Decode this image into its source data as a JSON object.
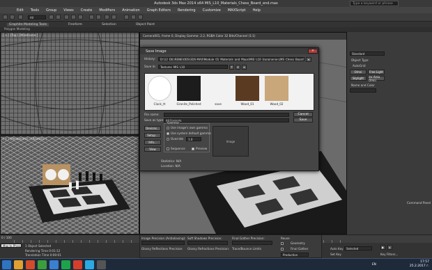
{
  "window": {
    "title": "Autodesk 3ds Max 2014 x64     MIS_L10_Materials_Chess_Board_end.max",
    "search_placeholder": "Type a keyword or phrase"
  },
  "menu": [
    "Edit",
    "Tools",
    "Group",
    "Views",
    "Create",
    "Modifiers",
    "Animation",
    "Graph Editors",
    "Rendering",
    "Customize",
    "MAXScript",
    "Help"
  ],
  "ribbon": {
    "tabs": [
      "Graphite Modeling Tools",
      "Freeform",
      "Selection",
      "Object Paint"
    ],
    "sub": "Polygon Modeling",
    "toolbar_select": "All"
  },
  "viewports": {
    "top_left": "[ + ] [Top ] [Wireframe ]",
    "bottom_left": "[ + ] [Perspective ] [Realistic ]",
    "right": "Camera001, frame 0, Display Gamma: 2.2, RGBA Color 32 Bits/Channel (1:1)"
  },
  "dialog": {
    "title": "Save Image",
    "history_label": "History:",
    "history_value": "D:\\12_DIL\\RENE\\ODS\\3DS MAX\\Module_01_Materials_and_Maps\\MIS_L10_Uprajnenie-LMS_Chess_Board\\Textures_MIS",
    "save_in_label": "Save in:",
    "save_in_value": "Textures_MIS_L10",
    "thumbnails": [
      "Clock_tt",
      "Granite_Polished",
      "save",
      "Wood_01",
      "Wood_02"
    ],
    "file_name_label": "File name:",
    "save_as_label": "Save as type:",
    "save_as_value": "All Formats",
    "save_button": "Save",
    "cancel_button": "Cancel",
    "setup_button": "Setup...",
    "devices_button": "Devices...",
    "info_button": "Info...",
    "view_button": "View",
    "gamma_title": "Gamma",
    "gamma_options": [
      "Use image's own gamma",
      "Use system default gamma",
      "Override"
    ],
    "gamma_override_value": "1.0",
    "sequence_label": "Sequence",
    "preview_label": "Preview",
    "image_label": "Image",
    "statistics": "Statistics: N/A",
    "location": "Location: N/A"
  },
  "command_panel": {
    "dropdown": "Standard",
    "object_type": "Object Type",
    "auto_grid": "AutoGrid",
    "buttons": [
      "Omni",
      "Free Light",
      "Skylight",
      "mr Area Omni"
    ],
    "name_color": "Name and Color",
    "title": "Command Panel"
  },
  "status": {
    "objects": "1 Object Selected",
    "render_time": "Rendering Time  0:01:12",
    "translation_time": "Translation Time  0:00:01",
    "maxscript": "Max to Physc"
  },
  "render_panel": {
    "image_precision": "Image Precision (Antialiasing):",
    "soft_shadows": "Soft Shadows Precision:",
    "final_gather": "Final Gather Precision:",
    "reuse": "Reuse",
    "glossy_refl": "Glossy Reflections Precision:",
    "glossy_refr": "Glossy Refractions Precision:",
    "trace_bounce": "Trace/Bounce Limits",
    "production": "Production",
    "geometry": "Geometry",
    "final_gather_chk": "Final Gather"
  },
  "animation": {
    "auto_key": "Auto Key",
    "selected": "Selected",
    "set_key": "Set Key",
    "key_filters": "Key Filters..."
  },
  "timeline": {
    "frame": "0 / 100"
  },
  "taskbar": {
    "language": "EN",
    "time": "17:57",
    "date": "25.2.2017 г."
  }
}
